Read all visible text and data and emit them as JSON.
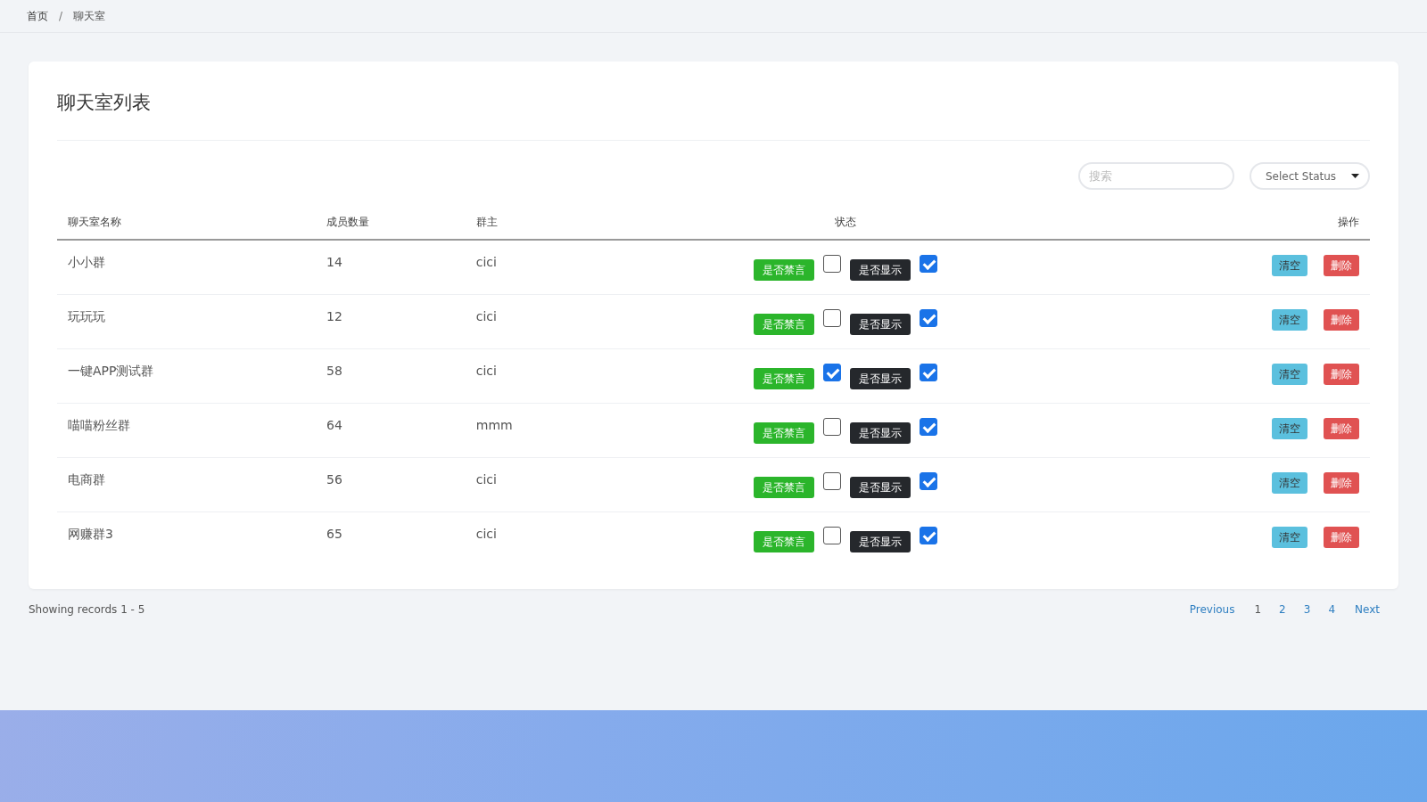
{
  "breadcrumb": [
    {
      "label": "首页",
      "kind": "link"
    },
    {
      "label": "/",
      "kind": "separator"
    },
    {
      "label": "聊天室",
      "kind": "current"
    }
  ],
  "card": {
    "title": "聊天室列表",
    "search": {
      "placeholder": "搜索"
    },
    "status_select": {
      "value": "Select Status"
    },
    "table": {
      "columns": [
        "聊天室名称",
        "成员数量",
        "群主",
        "状态",
        "操作"
      ],
      "rows": [
        {
          "name": "小小群",
          "members": "14",
          "owner": "cici",
          "mute_label": "是否禁言",
          "muted": false,
          "show_label": "是否显示",
          "shown": true,
          "clear_label": "清空",
          "delete_label": "删除"
        },
        {
          "name": "玩玩玩",
          "members": "12",
          "owner": "cici",
          "mute_label": "是否禁言",
          "muted": false,
          "show_label": "是否显示",
          "shown": true,
          "clear_label": "清空",
          "delete_label": "删除"
        },
        {
          "name": "一键APP测试群",
          "members": "58",
          "owner": "cici",
          "mute_label": "是否禁言",
          "muted": true,
          "show_label": "是否显示",
          "shown": true,
          "clear_label": "清空",
          "delete_label": "删除"
        },
        {
          "name": "喵喵粉丝群",
          "members": "64",
          "owner": "mmm",
          "mute_label": "是否禁言",
          "muted": false,
          "show_label": "是否显示",
          "shown": true,
          "clear_label": "清空",
          "delete_label": "删除"
        },
        {
          "name": "电商群",
          "members": "56",
          "owner": "cici",
          "mute_label": "是否禁言",
          "muted": false,
          "show_label": "是否显示",
          "shown": true,
          "clear_label": "清空",
          "delete_label": "删除"
        },
        {
          "name": "网赚群3",
          "members": "65",
          "owner": "cici",
          "mute_label": "是否禁言",
          "muted": false,
          "show_label": "是否显示",
          "shown": true,
          "clear_label": "清空",
          "delete_label": "删除"
        }
      ]
    }
  },
  "footer": {
    "records": "Showing records 1 - 5",
    "pagination": [
      {
        "label": "Previous",
        "kind": "nav",
        "selected": false
      },
      {
        "label": "1",
        "kind": "page",
        "selected": true
      },
      {
        "label": "2",
        "kind": "page",
        "selected": false
      },
      {
        "label": "3",
        "kind": "page",
        "selected": false
      },
      {
        "label": "4",
        "kind": "page",
        "selected": false
      },
      {
        "label": "Next",
        "kind": "nav",
        "selected": false
      }
    ]
  }
}
